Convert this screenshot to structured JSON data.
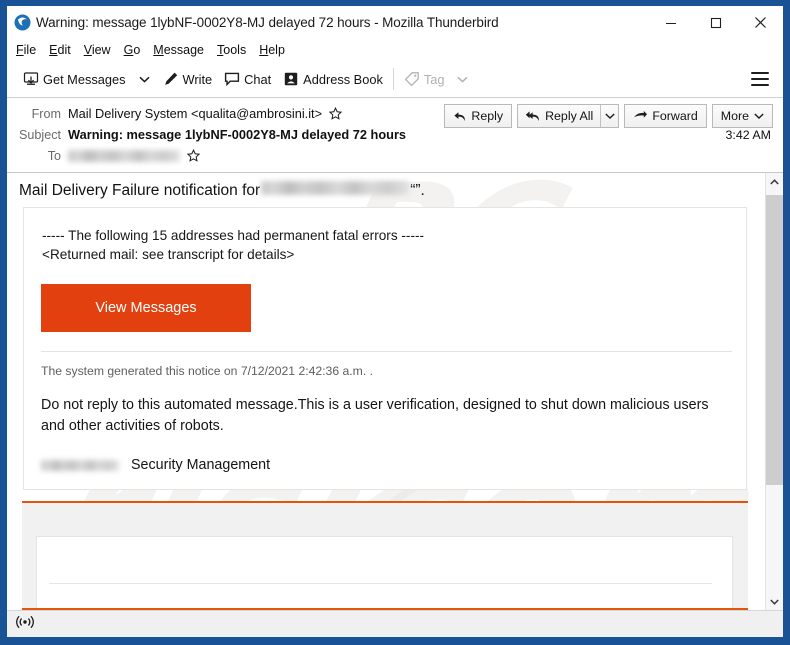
{
  "window": {
    "title": "Warning: message 1lybNF-0002Y8-MJ delayed 72 hours - Mozilla Thunderbird",
    "app_icon": "thunderbird-icon",
    "frame_color": "#1a5296",
    "controls": {
      "minimize": "minimize-icon",
      "maximize": "maximize-icon",
      "close": "close-icon"
    }
  },
  "menubar": {
    "items": [
      {
        "label": "File",
        "accesskey": "F"
      },
      {
        "label": "Edit",
        "accesskey": "E"
      },
      {
        "label": "View",
        "accesskey": "V"
      },
      {
        "label": "Go",
        "accesskey": "G"
      },
      {
        "label": "Message",
        "accesskey": "M"
      },
      {
        "label": "Tools",
        "accesskey": "T"
      },
      {
        "label": "Help",
        "accesskey": "H"
      }
    ]
  },
  "toolbar": {
    "get_messages": "Get Messages",
    "get_messages_icon": "download-mail-icon",
    "get_messages_caret": "chevron-down-icon",
    "write": "Write",
    "write_icon": "pencil-icon",
    "chat": "Chat",
    "chat_icon": "speech-bubble-icon",
    "address_book": "Address Book",
    "address_book_icon": "contact-card-icon",
    "tag": "Tag",
    "tag_icon": "tag-icon",
    "tag_caret": "chevron-down-icon",
    "tag_disabled": true,
    "app_menu_icon": "hamburger-menu-icon"
  },
  "message": {
    "from_label": "From",
    "from_value": "Mail Delivery System <qualita@ambrosini.it>",
    "from_star_icon": "star-icon",
    "subject_label": "Subject",
    "subject_value": "Warning: message 1lybNF-0002Y8-MJ delayed 72 hours",
    "to_label": "To",
    "to_value_redacted": true,
    "to_star_icon": "star-icon",
    "timestamp": "3:42 AM",
    "actions": {
      "reply": "Reply",
      "reply_icon": "reply-arrow-icon",
      "reply_all": "Reply All",
      "reply_all_icon": "reply-all-arrow-icon",
      "reply_all_caret": "chevron-down-icon",
      "forward": "Forward",
      "forward_icon": "forward-arrow-icon",
      "more": "More",
      "more_caret": "chevron-down-icon"
    }
  },
  "body": {
    "title_prefix": "Mail Delivery Failure notification for ",
    "title_redacted": true,
    "title_suffix": "“”.",
    "error_line_1": "----- The following 15 addresses had permanent fatal errors -----",
    "error_line_2": "<Returned mail: see transcript for details>",
    "cta_label": "View Messages",
    "cta_color": "#e2400e",
    "notice": "The system generated this notice on 7/12/2021 2:42:36 a.m. .",
    "warning_paragraph": "Do not reply to this automated message.This is a user verification, designed to shut down malicious users and other  activities of  robots.",
    "signature_redacted": true,
    "signature_text": "Security Management",
    "accent_rule_color": "#e2550e"
  },
  "watermark": {
    "lines": [
      "PC",
      "risk",
      "com"
    ]
  },
  "scrollbar": {
    "up_icon": "chevron-up-icon",
    "down_icon": "chevron-down-icon"
  },
  "statusbar": {
    "icon": "broadcast-signal-icon"
  }
}
